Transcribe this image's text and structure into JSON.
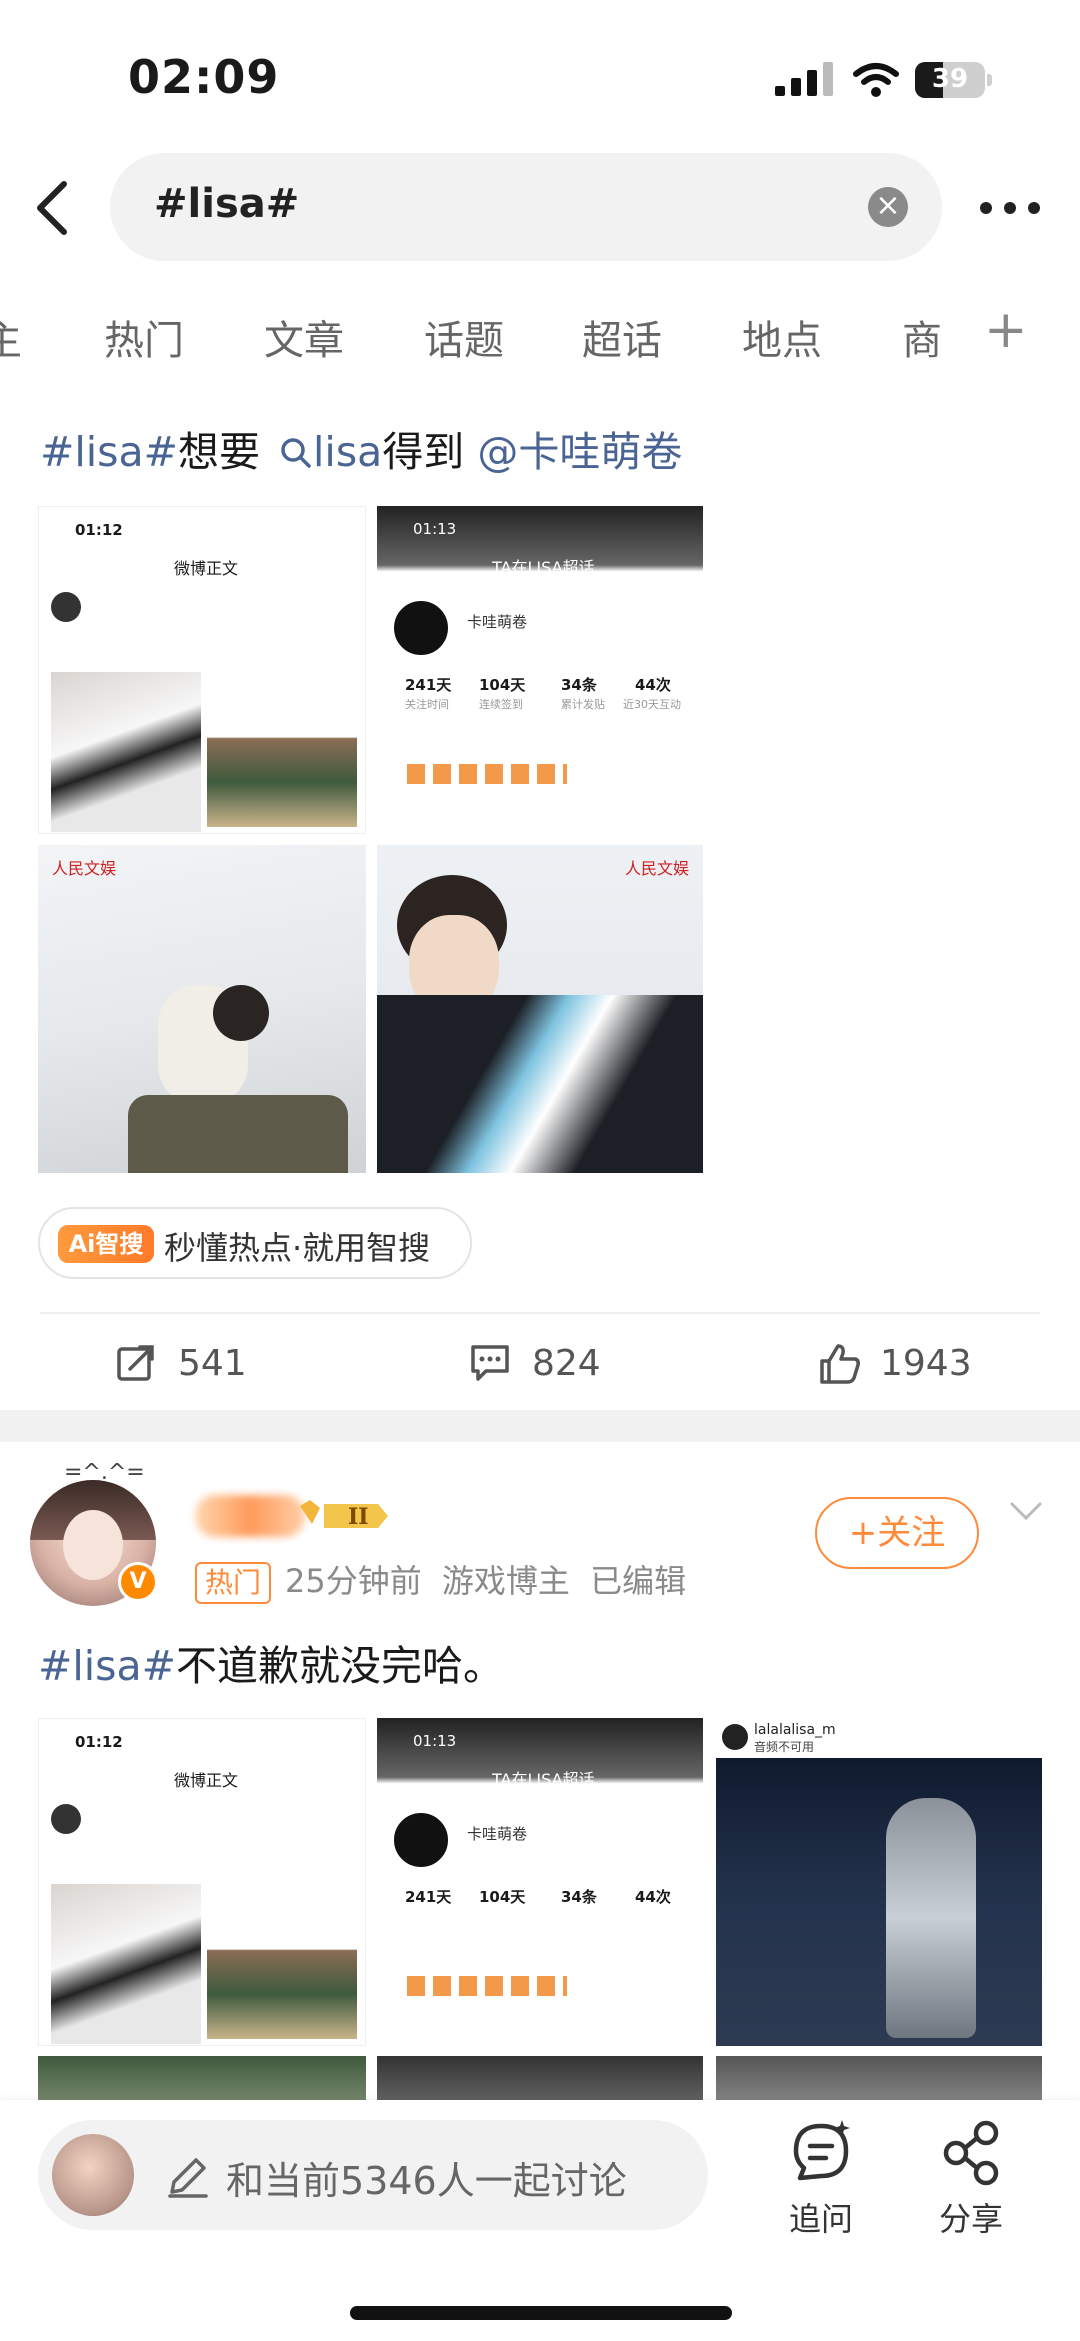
{
  "status_bar": {
    "time": "02:09",
    "battery": "39"
  },
  "search": {
    "query": "#lisa#"
  },
  "tabs": [
    {
      "label": "主"
    },
    {
      "label": "热门"
    },
    {
      "label": "文章"
    },
    {
      "label": "话题"
    },
    {
      "label": "超话"
    },
    {
      "label": "地点"
    },
    {
      "label": "商"
    }
  ],
  "post1": {
    "text_topic": "#lisa#",
    "text_mid1": "想要",
    "text_link": "lisa",
    "text_mid2": "得到",
    "text_mention": "@卡哇萌卷",
    "images": [
      {
        "label": "微博正文",
        "time": "01:12"
      },
      {
        "label": "TA在LISA超话",
        "time": "01:13",
        "name": "卡哇萌卷"
      },
      {
        "label": "人民文娱"
      },
      {
        "label": "人民文娱"
      }
    ],
    "stats_in_shot": [
      {
        "value": "241天",
        "label": "关注时间"
      },
      {
        "value": "104天",
        "label": "连续签到"
      },
      {
        "value": "34条",
        "label": "累计发贴"
      },
      {
        "value": "44次",
        "label": "近30天互动"
      }
    ],
    "ai_badge": "Ai智搜",
    "ai_text": "秒懂热点·就用智搜",
    "reposts": "541",
    "comments": "824",
    "likes": "1943"
  },
  "post2": {
    "avatar_deco": "=^.^=",
    "hot_tag": "热门",
    "time": "25分钟前",
    "role": "游戏博主",
    "edited": "已编辑",
    "follow": "+关注",
    "text_topic": "#lisa#",
    "text_body": "不道歉就没完哈。",
    "image3_user": "lalalalisa_m",
    "image3_sub": "音频不可用"
  },
  "bottom": {
    "placeholder": "和当前5346人一起讨论",
    "ask": "追问",
    "share": "分享"
  },
  "colors": {
    "accent": "#ff8a3a",
    "topic": "#4a6494"
  }
}
